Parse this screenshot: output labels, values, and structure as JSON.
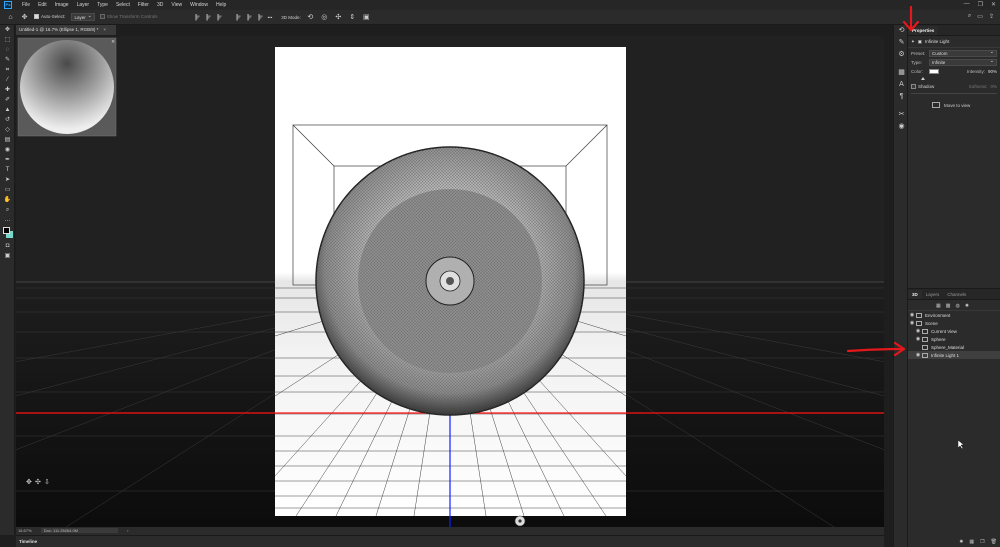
{
  "app": {
    "logo": "Ps"
  },
  "menu": [
    "File",
    "Edit",
    "Image",
    "Layer",
    "Type",
    "Select",
    "Filter",
    "3D",
    "View",
    "Window",
    "Help"
  ],
  "window_controls": [
    "—",
    "❐",
    "✕"
  ],
  "options_bar": {
    "auto_select_label": "Auto-Select:",
    "layer_select": "Layer",
    "transform_controls": "Show Transform Controls",
    "mode_label": "3D Mode:",
    "more": "•••"
  },
  "document": {
    "tab_title": "Untitled-1 @ 16.7% (Ellipse 1, RGB/8) *",
    "close": "×"
  },
  "status": {
    "zoom": "16.67%",
    "doc_size": "Doc: 111.2M/64.0M",
    "arrow": "›"
  },
  "timeline": {
    "label": "Timeline"
  },
  "properties": {
    "tab": "Properties",
    "header_label": "Infinite Light",
    "preset_label": "Preset:",
    "preset_value": "Custom",
    "type_label": "Type:",
    "type_value": "Infinite",
    "color_label": "Color:",
    "intensity_label": "Intensity:",
    "intensity_value": "90%",
    "shadow_label": "Shadow",
    "softness_label": "Softness:",
    "softness_value": "0%",
    "move_to_view": "Move to view"
  },
  "layers_panel": {
    "tabs": [
      "3D",
      "Layers",
      "Channels"
    ],
    "rows": [
      {
        "label": "Environment",
        "indent": 0,
        "selected": false
      },
      {
        "label": "Scene",
        "indent": 0,
        "selected": false
      },
      {
        "label": "Current View",
        "indent": 1,
        "selected": false
      },
      {
        "label": "Sphere",
        "indent": 1,
        "selected": false
      },
      {
        "label": "Sphere_Material",
        "indent": 2,
        "selected": false
      },
      {
        "label": "Infinite Light 1",
        "indent": 1,
        "selected": true
      }
    ]
  },
  "colors": {
    "annotation_red": "#e4181c",
    "ground_red_line": "#ff1010",
    "ground_blue_line": "#1020ff",
    "foreground_swatch": "#000000",
    "background_swatch": "#7ad6c8"
  }
}
